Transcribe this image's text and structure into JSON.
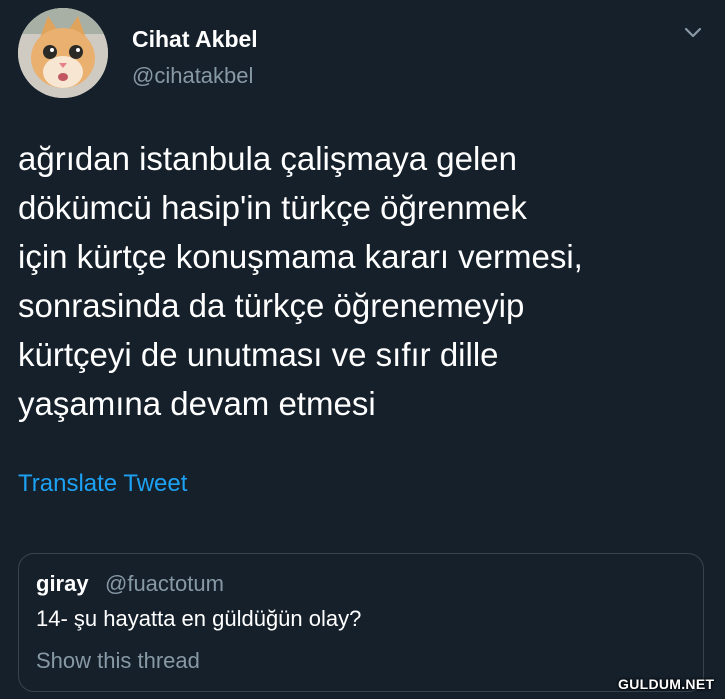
{
  "tweet": {
    "author_name": "Cihat Akbel",
    "author_handle": "@cihatakbel",
    "avatar_icon": "cat-avatar",
    "menu_icon": "chevron-down-icon",
    "text": "ağrıdan istanbula çalişmaya gelen\ndökümcü hasip'in türkçe öğrenmek\niçin kürtçe konuşmama kararı vermesi,\nsonrasinda da türkçe öğrenemeyip\nkürtçeyi de unutması ve sıfır dille\nyaşamına devam etmesi",
    "translate_label": "Translate Tweet"
  },
  "quoted": {
    "author_name": "giray",
    "author_handle": "@fuactotum",
    "text": "14- şu hayatta en güldüğün olay?",
    "thread_label": "Show this thread"
  },
  "watermark": "GULDUM.NET",
  "colors": {
    "background": "#15202b",
    "link": "#1da1f2",
    "muted": "#8899a6",
    "border": "#38444d"
  }
}
